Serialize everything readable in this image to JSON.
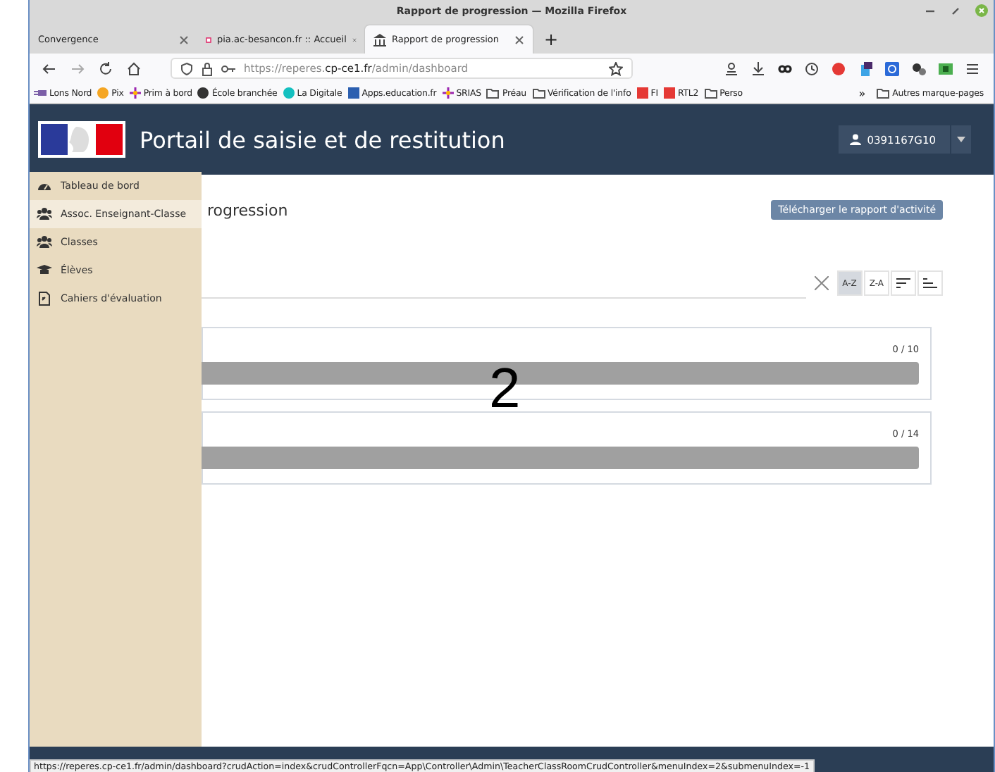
{
  "window": {
    "title": "Rapport de progression — Mozilla Firefox"
  },
  "tabs": [
    {
      "label": "Convergence",
      "selected": false,
      "kind": "plain"
    },
    {
      "label": "pia.ac-besancon.fr :: Accueil",
      "selected": false,
      "kind": "logo"
    },
    {
      "label": "Rapport de progression",
      "selected": true,
      "kind": "bank"
    }
  ],
  "new_tab": "+",
  "url": {
    "prefix": "https://reperes.",
    "domain": "cp-ce1.fr",
    "path": "/admin/dashboard"
  },
  "bookmarks": [
    {
      "label": "Lons Nord",
      "kind": "plug"
    },
    {
      "label": "Pix",
      "kind": "dot",
      "color": "#f5a623"
    },
    {
      "label": "Prim à bord",
      "kind": "star"
    },
    {
      "label": "École branchée",
      "kind": "dot",
      "color": "#333333"
    },
    {
      "label": "La Digitale",
      "kind": "dot",
      "color": "#14c0c0"
    },
    {
      "label": "Apps.education.fr",
      "kind": "square",
      "color": "#2b5fb0"
    },
    {
      "label": "SRIAS",
      "kind": "star"
    },
    {
      "label": "Préau",
      "kind": "folder"
    },
    {
      "label": "Vérification de l'info",
      "kind": "folder"
    },
    {
      "label": "FI",
      "kind": "square",
      "color": "#e53935"
    },
    {
      "label": "RTL2",
      "kind": "square",
      "color": "#e53935"
    },
    {
      "label": "Perso",
      "kind": "folder"
    }
  ],
  "bookmarks_overflow": "»",
  "other_bookmarks": "Autres marque-pages",
  "app": {
    "title": "Portail de saisie et de restitution",
    "user": "0391167G10"
  },
  "sidebar": {
    "items": [
      {
        "label": "Tableau de bord",
        "kind": "gauge",
        "selected": false
      },
      {
        "label": "Assoc. Enseignant-Classe",
        "kind": "users",
        "selected": true
      },
      {
        "label": "Classes",
        "kind": "users",
        "selected": false
      },
      {
        "label": "Élèves",
        "kind": "cap",
        "selected": false
      },
      {
        "label": "Cahiers d'évaluation",
        "kind": "doc",
        "selected": false
      }
    ]
  },
  "page": {
    "title": "rogression",
    "download_button": "Télécharger le rapport d'activité"
  },
  "sort_buttons": [
    {
      "label": "A-Z",
      "kind": "text",
      "selected": true
    },
    {
      "label": "Z-A",
      "kind": "text",
      "selected": false
    },
    {
      "kind": "desc",
      "selected": false
    },
    {
      "kind": "asc",
      "selected": false
    }
  ],
  "cards": [
    {
      "count": "0 / 10",
      "level": 0
    },
    {
      "count": "0 / 14",
      "level": 0
    }
  ],
  "overlay_number": "2",
  "status_url": "https://reperes.cp-ce1.fr/admin/dashboard?crudAction=index&crudControllerFqcn=App\\Controller\\Admin\\TeacherClassRoomCrudController&menuIndex=2&submenuIndex=-1"
}
